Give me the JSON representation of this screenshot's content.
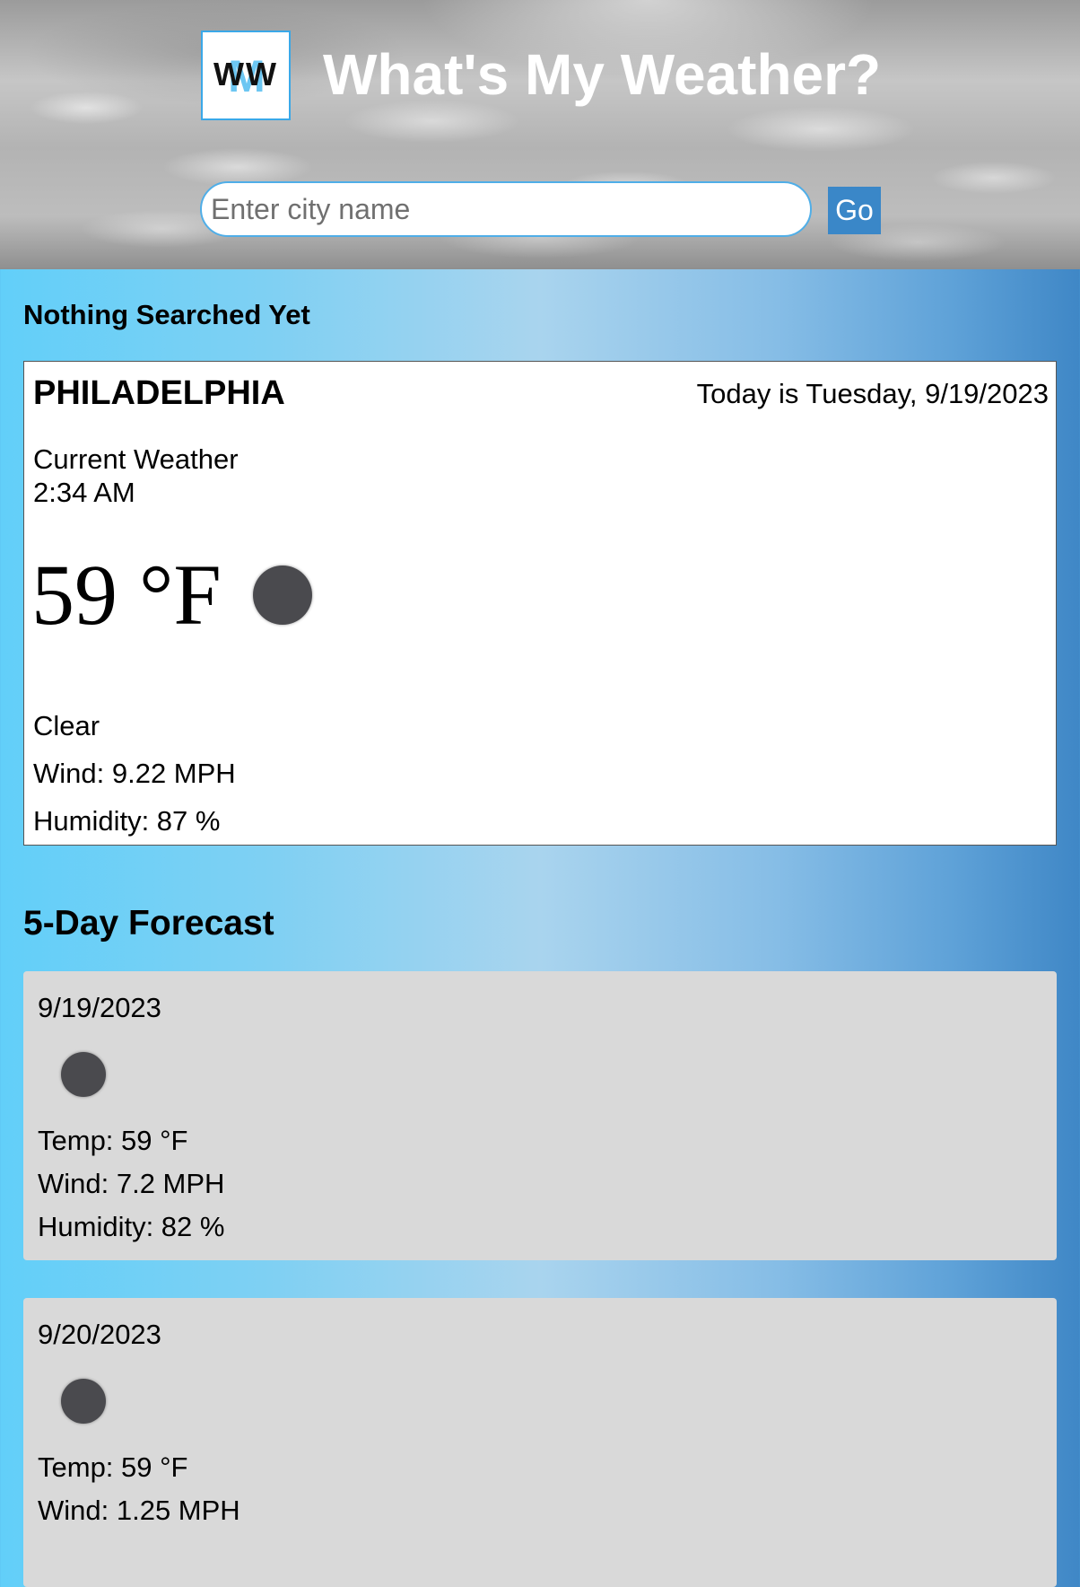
{
  "header": {
    "logo_text": "WW",
    "logo_icon": "ww-logo",
    "title": "What's My Weather?",
    "search": {
      "placeholder": "Enter city name",
      "value": ""
    },
    "go_label": "Go"
  },
  "history": {
    "title": "Nothing Searched Yet"
  },
  "current": {
    "city": "PHILADELPHIA",
    "today": "Today is Tuesday, 9/19/2023",
    "label": "Current Weather",
    "time": "2:34 AM",
    "temp": "59 °F",
    "icon": "moon-icon",
    "condition": "Clear",
    "wind": "Wind: 9.22 MPH",
    "humidity": "Humidity: 87 %"
  },
  "forecast": {
    "title": "5-Day Forecast",
    "days": [
      {
        "date": "9/19/2023",
        "icon": "moon-icon",
        "temp": "Temp: 59 °F",
        "wind": "Wind: 7.2 MPH",
        "humidity": "Humidity: 82 %"
      },
      {
        "date": "9/20/2023",
        "icon": "moon-icon",
        "temp": "Temp: 59 °F",
        "wind": "Wind: 1.25 MPH"
      }
    ]
  },
  "colors": {
    "accent": "#3a87c8",
    "input_border": "#4faee8",
    "card_bg": "#ffffff",
    "forecast_card_bg": "#d9d9d9",
    "icon_color": "#4a4a4e"
  }
}
